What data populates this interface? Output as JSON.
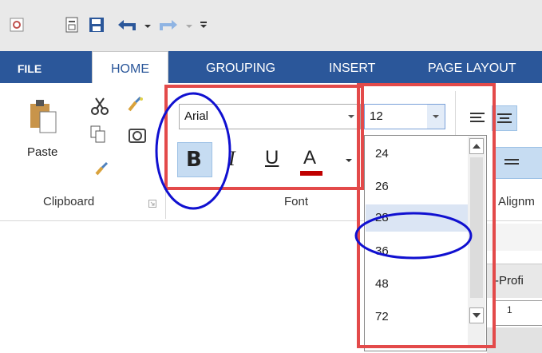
{
  "tabs": {
    "file": "FILE",
    "home": "HOME",
    "grouping": "GROUPING",
    "insert": "INSERT",
    "page_layout": "PAGE LAYOUT"
  },
  "clipboard": {
    "paste_label": "Paste",
    "group_label": "Clipboard"
  },
  "font": {
    "font_name": "Arial",
    "font_size": "12",
    "group_label": "Font",
    "bold": "B",
    "italic": "I",
    "underline": "U",
    "color": "A"
  },
  "size_options": [
    "24",
    "26",
    "28",
    "36",
    "48",
    "72"
  ],
  "selected_size": "28",
  "alignment": {
    "group_label": "Alignm"
  },
  "sheet": {
    "cell_text": "-Profi",
    "ruler_text": "1"
  },
  "colors": {
    "tab_blue": "#2b579a",
    "highlight_red": "#e34a4a",
    "annotation_blue": "#1010d0",
    "font_color_red": "#c00000"
  }
}
